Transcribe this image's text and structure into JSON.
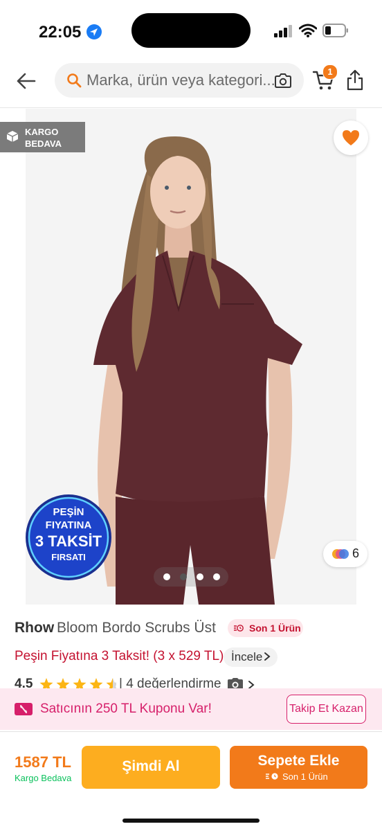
{
  "status": {
    "time": "22:05"
  },
  "header": {
    "search_placeholder": "Marka, ürün veya kategori...",
    "cart_count": "1"
  },
  "gallery": {
    "cargo_line1": "KARGO",
    "cargo_line2": "BEDAVA",
    "color_count": "6",
    "slide_count": 4,
    "active_slide": 1,
    "promo_badge": {
      "line1": "PEŞİN",
      "line2": "FIYATINA",
      "line3": "3 TAKSİT",
      "line4": "FIRSATI"
    }
  },
  "product": {
    "brand": "Rhow",
    "name": "Bloom Bordo Scrubs Üst",
    "stock_badge": "Son 1 Ürün",
    "installment_text": "Peşin Fiyatına 3 Taksit! (3 x 529 TL)",
    "installment_link": "İncele",
    "rating": "4.5",
    "rating_stars": 4.5,
    "rating_count": "| 4 değerlendirme"
  },
  "coupon": {
    "text": "Satıcının 250 TL Kuponu Var!",
    "button": "Takip Et Kazan"
  },
  "bottom": {
    "price": "1587 TL",
    "price_sub": "Kargo Bedava",
    "buy_now": "Şimdi Al",
    "add_to_cart": "Sepete Ekle",
    "add_to_cart_sub": "Son 1 Ürün"
  },
  "colors": {
    "brand_orange": "#f27a1a",
    "buy_yellow": "#fdad1f",
    "pink": "#d61f6a",
    "red": "#c41230",
    "green": "#0bc15c",
    "garment": "#5e2a30"
  }
}
